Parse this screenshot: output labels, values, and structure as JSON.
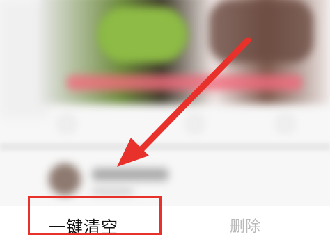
{
  "bottom_bar": {
    "clear_all_label": "一键清空",
    "delete_label": "删除"
  },
  "colors": {
    "annotation_red": "#e8312a",
    "delete_disabled": "#b9b9b9"
  }
}
